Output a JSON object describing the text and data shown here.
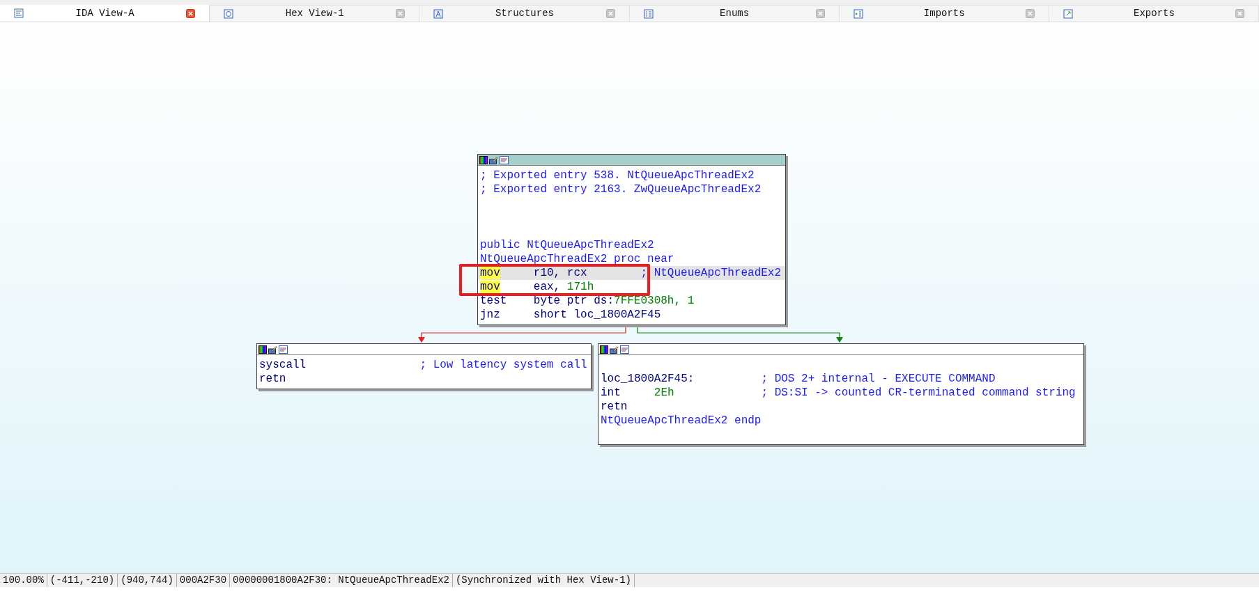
{
  "tabs": [
    {
      "label": "IDA View-A",
      "kind": "view",
      "selected": true
    },
    {
      "label": "Hex View-1",
      "kind": "hex",
      "selected": false
    },
    {
      "label": "Structures",
      "kind": "struct",
      "selected": false
    },
    {
      "label": "Enums",
      "kind": "enum",
      "selected": false
    },
    {
      "label": "Imports",
      "kind": "import",
      "selected": false
    },
    {
      "label": "Exports",
      "kind": "export",
      "selected": false
    }
  ],
  "graph": {
    "nodes": [
      {
        "kind": "entry",
        "lines": [
          {
            "kind": "comment",
            "text": "; Exported entry 538. NtQueueApcThreadEx2"
          },
          {
            "kind": "comment",
            "text": "; Exported entry 2163. ZwQueueApcThreadEx2"
          },
          {
            "kind": "blank"
          },
          {
            "kind": "blank"
          },
          {
            "kind": "blank"
          },
          {
            "kind": "directive",
            "text": "public NtQueueApcThreadEx2"
          },
          {
            "kind": "directive",
            "text": "NtQueueApcThreadEx2 proc near"
          },
          {
            "kind": "instruction",
            "mnemonic": "mov",
            "operands": [
              {
                "text": "r10, rcx",
                "kind": "plain"
              }
            ],
            "comment": "; NtQueueApcThreadEx2",
            "highlighted": true,
            "current": true
          },
          {
            "kind": "instruction",
            "mnemonic": "mov",
            "operands": [
              {
                "text": "eax, ",
                "kind": "plain"
              },
              {
                "text": "171h",
                "kind": "number"
              }
            ],
            "highlighted": true,
            "current": false
          },
          {
            "kind": "instruction",
            "mnemonic": "test",
            "operands": [
              {
                "text": "byte ptr ds:",
                "kind": "plain"
              },
              {
                "text": "7FFE0308h, 1",
                "kind": "number"
              }
            ],
            "highlighted": false,
            "current": false
          },
          {
            "kind": "instruction",
            "mnemonic": "jnz",
            "operands": [
              {
                "text": "short loc_1800A2F45",
                "kind": "plain"
              }
            ],
            "highlighted": false,
            "current": false
          }
        ]
      },
      {
        "kind": "plain",
        "lines": [
          {
            "kind": "instruction",
            "mnemonic": "syscall",
            "comment": "; Low latency system call",
            "highlighted": false,
            "current": false
          },
          {
            "kind": "instruction",
            "mnemonic": "retn",
            "highlighted": false,
            "current": false
          }
        ]
      },
      {
        "kind": "plain",
        "lines": [
          {
            "kind": "blank"
          },
          {
            "kind": "label",
            "text": "loc_1800A2F45:",
            "comment": "; DOS 2+ internal - EXECUTE COMMAND"
          },
          {
            "kind": "instruction",
            "mnemonic": "int",
            "operands": [
              {
                "text": "2Eh",
                "kind": "number"
              }
            ],
            "comment": "; DS:SI -> counted CR-terminated command string",
            "highlighted": false,
            "current": false
          },
          {
            "kind": "instruction",
            "mnemonic": "retn",
            "highlighted": false,
            "current": false
          },
          {
            "kind": "directive",
            "text": "NtQueueApcThreadEx2 endp"
          },
          {
            "kind": "blank"
          }
        ]
      }
    ],
    "edges": [
      {
        "kind": "taken"
      },
      {
        "kind": "fallthrough"
      }
    ]
  },
  "status_bar": [
    "100.00%",
    "(-411,-210)",
    "(940,744)",
    "000A2F30",
    "00000001800A2F30: NtQueueApcThreadEx2",
    "(Synchronized with Hex View-1)"
  ]
}
